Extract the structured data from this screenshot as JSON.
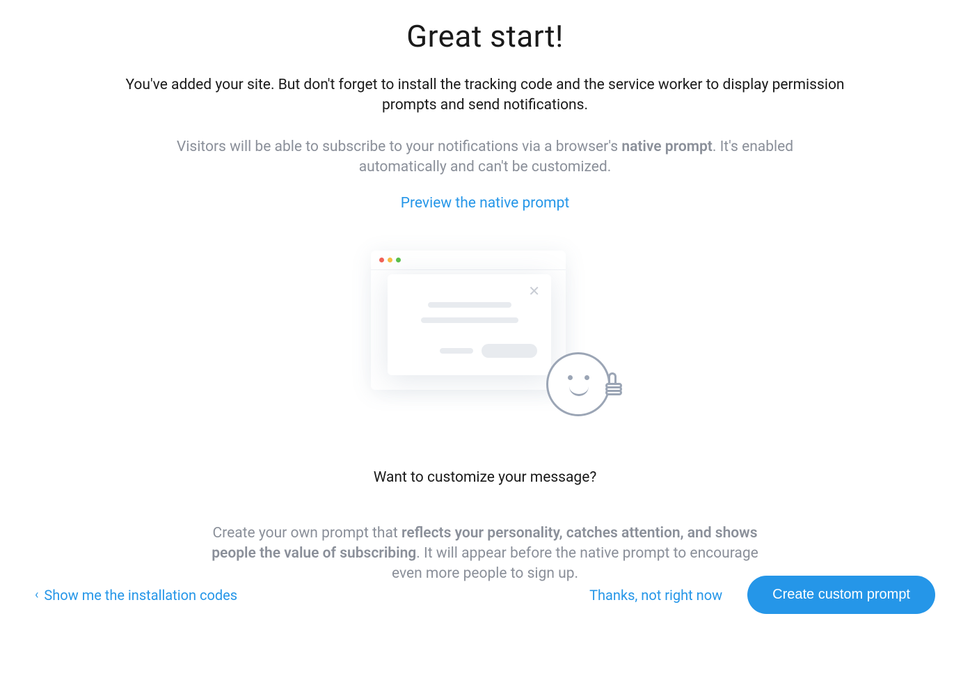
{
  "header": {
    "title": "Great start!",
    "subtitle": "You've added your site. But don't forget to install the tracking code and the service worker to display permission prompts and send notifications.",
    "description_pre": "Visitors will be able to subscribe to your notifications via a browser's ",
    "description_bold": "native prompt",
    "description_post": ". It's enabled automatically and can't be customized.",
    "preview_link": "Preview the native prompt"
  },
  "customize": {
    "title": "Want to customize your message?",
    "desc_pre": "Create your own prompt that ",
    "desc_bold": "reflects your personality, catches attention, and shows people the value of subscribing",
    "desc_post": ". It will appear before the native prompt to encourage even more people to sign up."
  },
  "footer": {
    "back": "Show me the installation codes",
    "skip": "Thanks, not right now",
    "primary": "Create custom prompt"
  }
}
